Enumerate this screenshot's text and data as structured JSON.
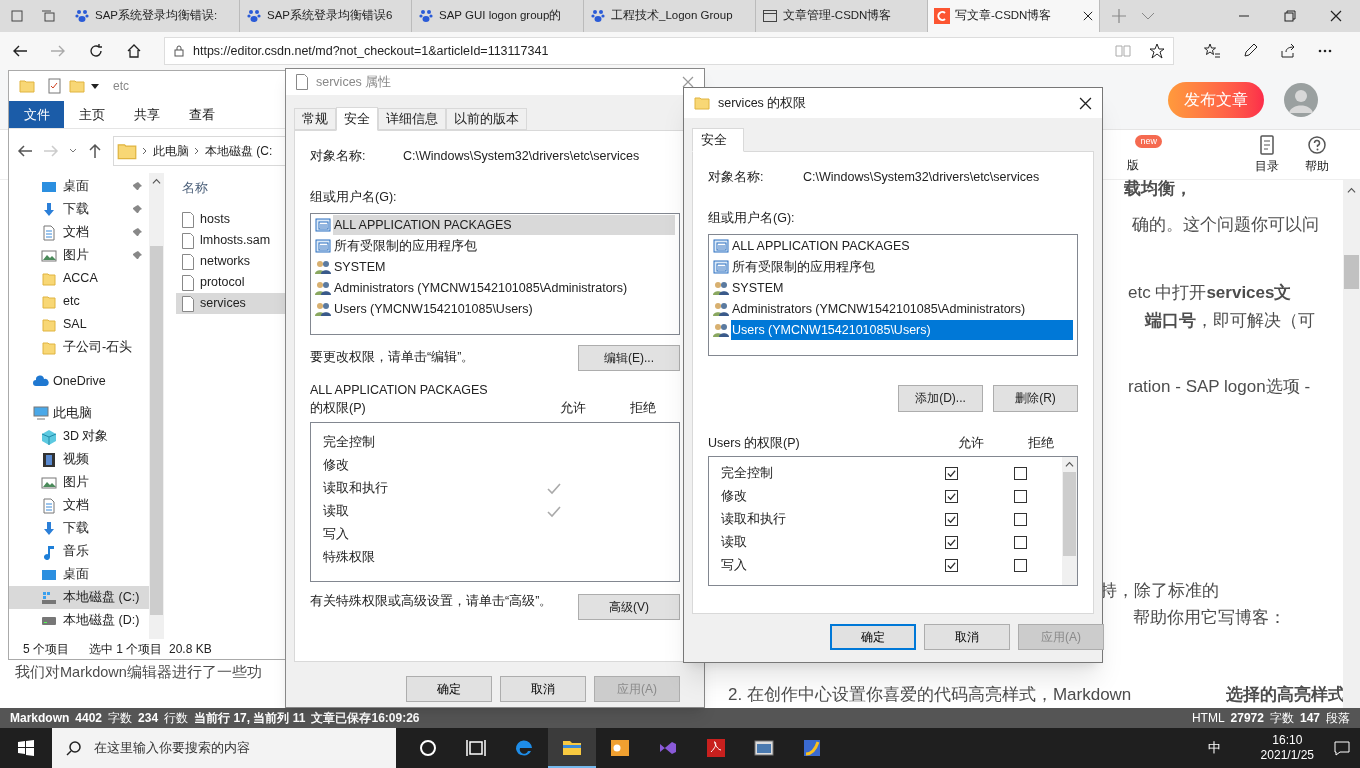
{
  "browser": {
    "tabs": [
      {
        "title": "SAP系统登录均衡错误:",
        "kind": "paw",
        "selected": false
      },
      {
        "title": "SAP系统登录均衡错误6",
        "kind": "paw",
        "selected": false
      },
      {
        "title": "SAP GUI logon group的",
        "kind": "paw",
        "selected": false
      },
      {
        "title": "工程技术_Logon Group",
        "kind": "paw",
        "selected": false
      },
      {
        "title": "文章管理-CSDN博客",
        "kind": "page",
        "selected": false
      },
      {
        "title": "写文章-CSDN博客",
        "kind": "csdn",
        "selected": true
      }
    ],
    "url": "https://editor.csdn.net/md?not_checkout=1&articleId=113117341"
  },
  "editor": {
    "publish_button": "发布文章",
    "template": {
      "label": "版",
      "badge": "new"
    },
    "toolbar": [
      "目录",
      "帮助"
    ],
    "article_lines": [
      "**载均衡，**",
      "确的。这个问题你可以问",
      "etc 中打开**services文**",
      "**端口号**，即可解决（可",
      "ration - SAP logon选项 -",
      "持，除了标准的",
      "帮助你用它写博客：",
      "2.  在创作中心设置你喜爱的代码高亮样式，Markdown",
      "**选择的高亮样式**"
    ],
    "left_line": "我们对Markdown编辑器进行了一些功",
    "status_left": [
      {
        "label": "Markdown",
        "bold": true
      },
      {
        "label": "4402",
        "bold": true
      },
      {
        "label": "字数",
        "bold": false
      },
      {
        "label": "234",
        "bold": true
      },
      {
        "label": "行数",
        "bold": false
      },
      {
        "label": "当前行 17, 当前列 11",
        "bold": true
      },
      {
        "label": "文章已保存16:09:26",
        "bold": true
      }
    ],
    "status_right": [
      {
        "label": "HTML",
        "bold": false
      },
      {
        "label": "27972",
        "bold": true
      },
      {
        "label": "字数",
        "bold": false
      },
      {
        "label": "147",
        "bold": true
      },
      {
        "label": "段落",
        "bold": false
      }
    ]
  },
  "explorer": {
    "title": "etc",
    "ribbon_tabs": [
      {
        "label": "文件",
        "selected": true
      },
      {
        "label": "主页",
        "selected": false
      },
      {
        "label": "共享",
        "selected": false
      },
      {
        "label": "查看",
        "selected": false
      }
    ],
    "breadcrumb": [
      "此电脑",
      "本地磁盘 (C:"
    ],
    "quick_access": [
      {
        "label": "桌面",
        "kind": "desktop",
        "pinned": true
      },
      {
        "label": "下载",
        "kind": "download",
        "pinned": true
      },
      {
        "label": "文档",
        "kind": "document",
        "pinned": true
      },
      {
        "label": "图片",
        "kind": "pictures",
        "pinned": true
      },
      {
        "label": "ACCA",
        "kind": "folder",
        "pinned": false
      },
      {
        "label": "etc",
        "kind": "folder",
        "pinned": false
      },
      {
        "label": "SAL",
        "kind": "folder",
        "pinned": false
      },
      {
        "label": "子公司-石头",
        "kind": "folder",
        "pinned": false
      }
    ],
    "onedrive": {
      "label": "OneDrive"
    },
    "this_pc": {
      "label": "此电脑",
      "children": [
        {
          "label": "3D 对象",
          "kind": "cube",
          "selected": false
        },
        {
          "label": "视频",
          "kind": "video",
          "selected": false
        },
        {
          "label": "图片",
          "kind": "pictures",
          "selected": false
        },
        {
          "label": "文档",
          "kind": "document",
          "selected": false
        },
        {
          "label": "下载",
          "kind": "download",
          "selected": false
        },
        {
          "label": "音乐",
          "kind": "music",
          "selected": false
        },
        {
          "label": "桌面",
          "kind": "desktop",
          "selected": false
        },
        {
          "label": "本地磁盘 (C:)",
          "kind": "drive_c",
          "selected": true
        },
        {
          "label": "本地磁盘 (D:)",
          "kind": "drive",
          "selected": false
        }
      ]
    },
    "column_header": "名称",
    "files": [
      {
        "name": "hosts",
        "selected": false
      },
      {
        "name": "lmhosts.sam",
        "selected": false
      },
      {
        "name": "networks",
        "selected": false
      },
      {
        "name": "protocol",
        "selected": false
      },
      {
        "name": "services",
        "selected": true
      }
    ],
    "status": [
      "5 个项目",
      "选中 1 个项目  20.8 KB"
    ]
  },
  "properties_dialog": {
    "title": "services 属性",
    "tabs": [
      {
        "label": "常规",
        "selected": false
      },
      {
        "label": "安全",
        "selected": true
      },
      {
        "label": "详细信息",
        "selected": false
      },
      {
        "label": "以前的版本",
        "selected": false
      }
    ],
    "object_label": "对象名称:",
    "object_path": "C:\\Windows\\System32\\drivers\\etc\\services",
    "group_label": "组或用户名(G):",
    "principals": [
      {
        "name": "ALL APPLICATION PACKAGES",
        "kind": "package",
        "selected": true
      },
      {
        "name": "所有受限制的应用程序包",
        "kind": "package",
        "selected": false
      },
      {
        "name": "SYSTEM",
        "kind": "group",
        "selected": false
      },
      {
        "name": "Administrators (YMCNW1542101085\\Administrators)",
        "kind": "group",
        "selected": false
      },
      {
        "name": "Users (YMCNW1542101085\\Users)",
        "kind": "group",
        "selected": false
      }
    ],
    "edit_hint": "要更改权限，请单击“编辑”。",
    "edit_button": "编辑(E)...",
    "perm_label": [
      "ALL APPLICATION PACKAGES",
      "的权限(P)"
    ],
    "allow_header": "允许",
    "deny_header": "拒绝",
    "permissions": [
      {
        "name": "完全控制",
        "allow": false,
        "deny": false
      },
      {
        "name": "修改",
        "allow": false,
        "deny": false
      },
      {
        "name": "读取和执行",
        "allow": true,
        "deny": false
      },
      {
        "name": "读取",
        "allow": true,
        "deny": false
      },
      {
        "name": "写入",
        "allow": false,
        "deny": false
      },
      {
        "name": "特殊权限",
        "allow": false,
        "deny": false
      }
    ],
    "advanced_hint": "有关特殊权限或高级设置，请单击“高级”。",
    "advanced_button": "高级(V)",
    "buttons": [
      {
        "label": "确定",
        "disabled": false
      },
      {
        "label": "取消",
        "disabled": false
      },
      {
        "label": "应用(A)",
        "disabled": true
      }
    ]
  },
  "permissions_dialog": {
    "title": "services 的权限",
    "tab": "安全",
    "object_label": "对象名称:",
    "object_path": "C:\\Windows\\System32\\drivers\\etc\\services",
    "group_label": "组或用户名(G):",
    "principals": [
      {
        "name": "ALL APPLICATION PACKAGES",
        "kind": "package",
        "selected": false
      },
      {
        "name": "所有受限制的应用程序包",
        "kind": "package",
        "selected": false
      },
      {
        "name": "SYSTEM",
        "kind": "group",
        "selected": false
      },
      {
        "name": "Administrators (YMCNW1542101085\\Administrators)",
        "kind": "group",
        "selected": false
      },
      {
        "name": "Users (YMCNW1542101085\\Users)",
        "kind": "group",
        "selected": true
      }
    ],
    "add_button": "添加(D)...",
    "remove_button": "删除(R)",
    "perm_label": "Users 的权限(P)",
    "allow_header": "允许",
    "deny_header": "拒绝",
    "permissions": [
      {
        "name": "完全控制",
        "allow": true,
        "deny": false
      },
      {
        "name": "修改",
        "allow": true,
        "deny": false
      },
      {
        "name": "读取和执行",
        "allow": true,
        "deny": false
      },
      {
        "name": "读取",
        "allow": true,
        "deny": false
      },
      {
        "name": "写入",
        "allow": true,
        "deny": false
      }
    ],
    "buttons": [
      {
        "label": "确定",
        "disabled": false,
        "default": true
      },
      {
        "label": "取消",
        "disabled": false,
        "default": false
      },
      {
        "label": "应用(A)",
        "disabled": true,
        "default": false
      }
    ]
  },
  "taskbar": {
    "search_placeholder": "在这里输入你要搜索的内容",
    "apps": [
      {
        "kind": "cortana",
        "active": false
      },
      {
        "kind": "taskview",
        "active": false
      },
      {
        "kind": "edge",
        "active": false
      },
      {
        "kind": "explorer",
        "active": true
      },
      {
        "kind": "outlook",
        "active": false
      },
      {
        "kind": "vs",
        "active": false
      },
      {
        "kind": "pdf",
        "active": false
      },
      {
        "kind": "app",
        "active": false
      },
      {
        "kind": "sap",
        "active": false
      }
    ],
    "ime": "中",
    "time": "16:10",
    "date": "2021/1/25"
  }
}
